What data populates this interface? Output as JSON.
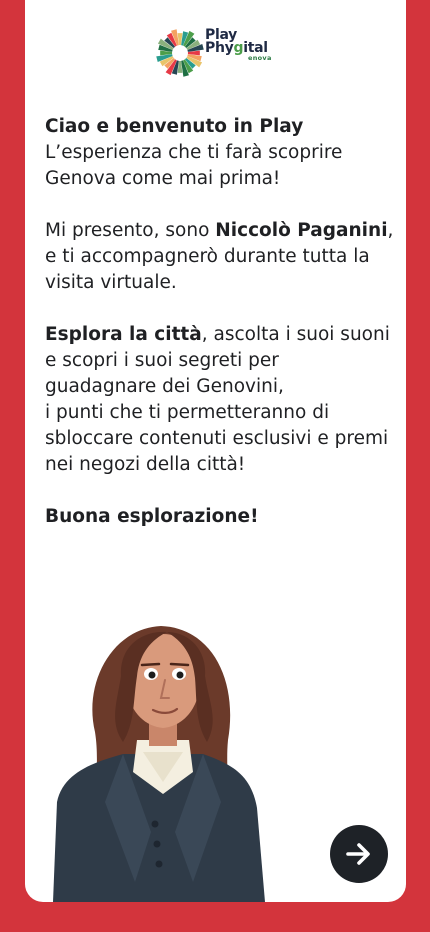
{
  "brand": {
    "logo_line1": "Play",
    "logo_line2_prefix": "Phy",
    "logo_line2_accent": "g",
    "logo_line2_suffix": "ital",
    "logo_sub": "enova",
    "logo_colors": [
      "#e63946",
      "#f4a261",
      "#e9c46a",
      "#2a9d8f",
      "#4c9e4a",
      "#1f6f43",
      "#8ab17d",
      "#264653"
    ]
  },
  "intro": {
    "heading": "Ciao e benvenuto in Play",
    "p1": "L’esperienza che ti farà scoprire Genova come mai prima!",
    "p2_a": "Mi presento, sono ",
    "p2_bold": "Niccolò Paganini",
    "p2_b": ", e ti accompagnerò durante tutta la visita virtuale.",
    "p3_bold": "Esplora la città",
    "p3_b": ", ascolta i suoi suoni e scopri i suoi segreti per guadagnare dei Genovini,",
    "p3_c": "i punti che ti permetteranno di sbloccare contenuti esclusivi e premi nei negozi della città!",
    "closing": "Buona esplorazione!"
  },
  "actions": {
    "next_icon": "arrow-right-icon"
  },
  "colors": {
    "background": "#d3343c",
    "card": "#ffffff",
    "button": "#1e2227"
  }
}
